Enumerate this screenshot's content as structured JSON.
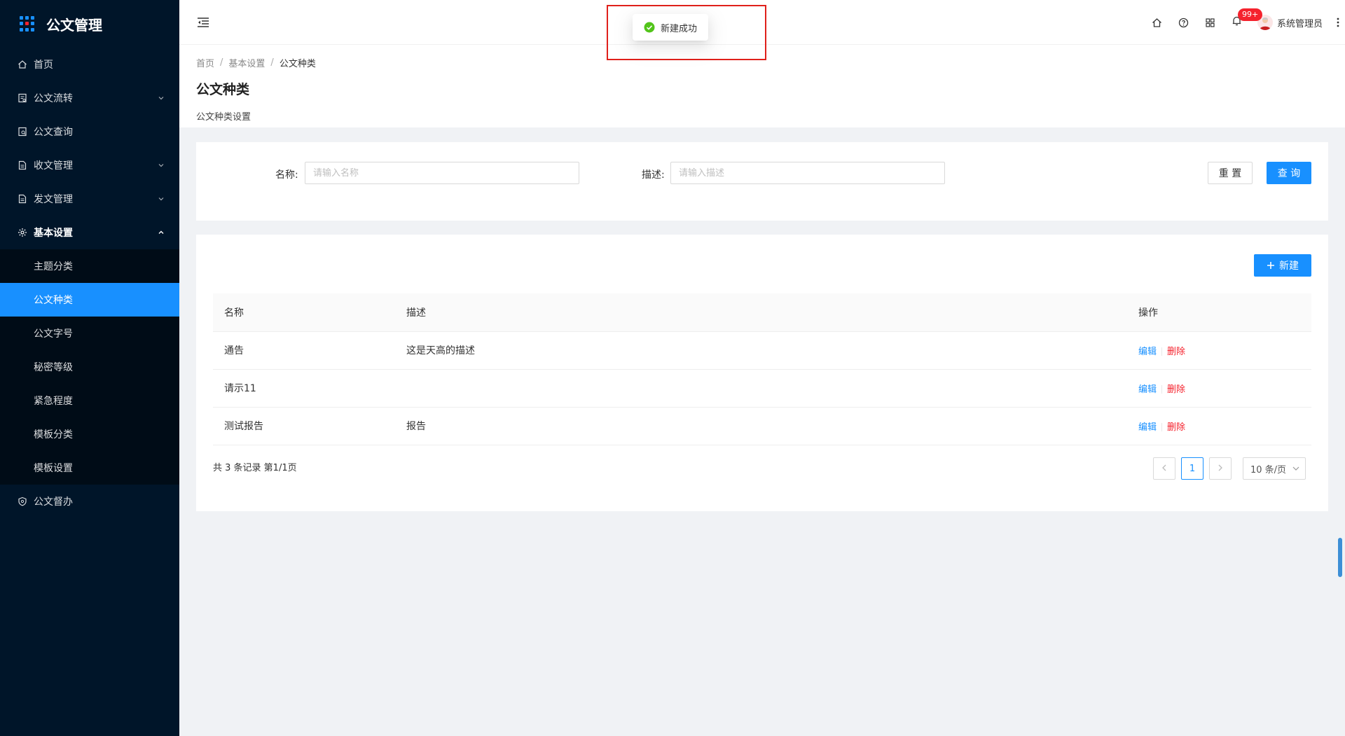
{
  "app": {
    "title": "公文管理"
  },
  "sidebar": {
    "items": [
      {
        "label": "首页",
        "icon": "home-icon"
      },
      {
        "label": "公文流转",
        "icon": "document-flow-icon",
        "has_arrow": true
      },
      {
        "label": "公文查询",
        "icon": "document-search-icon"
      },
      {
        "label": "收文管理",
        "icon": "receive-doc-icon",
        "has_arrow": true
      },
      {
        "label": "发文管理",
        "icon": "send-doc-icon",
        "has_arrow": true
      },
      {
        "label": "基本设置",
        "icon": "gear-icon",
        "expanded": true
      },
      {
        "label": "公文督办",
        "icon": "shield-icon"
      }
    ],
    "submenu": [
      {
        "label": "主题分类"
      },
      {
        "label": "公文种类",
        "active": true
      },
      {
        "label": "公文字号"
      },
      {
        "label": "秘密等级"
      },
      {
        "label": "紧急程度"
      },
      {
        "label": "模板分类"
      },
      {
        "label": "模板设置"
      }
    ]
  },
  "header": {
    "notification_badge": "99+",
    "user_name": "系统管理员"
  },
  "breadcrumb": {
    "home": "首页",
    "parent": "基本设置",
    "current": "公文种类"
  },
  "page": {
    "title": "公文种类",
    "description": "公文种类设置"
  },
  "search": {
    "name_label": "名称:",
    "name_placeholder": "请输入名称",
    "desc_label": "描述:",
    "desc_placeholder": "请输入描述",
    "reset_label": "重 置",
    "query_label": "查 询"
  },
  "table": {
    "new_label": "新建",
    "columns": {
      "name": "名称",
      "desc": "描述",
      "ops": "操作"
    },
    "rows": [
      {
        "name": "通告",
        "desc": "这是天高的描述"
      },
      {
        "name": "请示11",
        "desc": ""
      },
      {
        "name": "测试报告",
        "desc": "报告"
      }
    ],
    "edit_label": "编辑",
    "delete_label": "删除"
  },
  "pagination": {
    "total_text": "共 3 条记录 第1/1页",
    "current_page": "1",
    "page_size": "10 条/页"
  },
  "toast": {
    "message": "新建成功",
    "type": "success"
  },
  "colors": {
    "sidebar_bg": "#001529",
    "primary": "#1890ff",
    "danger": "#f5222d",
    "success": "#52c41a",
    "highlight": "#e0201b"
  }
}
